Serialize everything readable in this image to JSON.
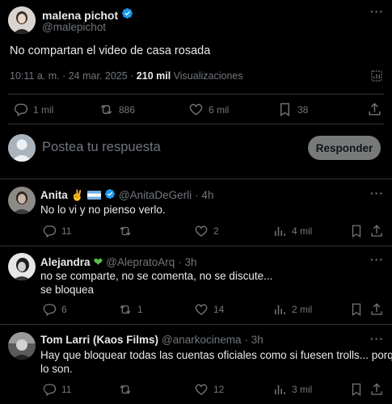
{
  "post": {
    "author_name": "malena pichot",
    "author_handle": "@malepichot",
    "text": "No compartan el video de casa rosada",
    "time": "10:11 a. m. · 24 mar. 2025 · ",
    "views_count": "210 mil",
    "views_label": " Visualizaciones",
    "actions": {
      "replies": "1 mil",
      "reposts": "886",
      "likes": "6 mil",
      "bookmarks": "38"
    }
  },
  "composer": {
    "placeholder": "Postea tu respuesta",
    "submit_label": "Responder"
  },
  "replies": [
    {
      "name": "Anita",
      "handle": "@AnitaDeGerli",
      "time": "· 4h",
      "text": "No lo vi y no pienso verlo.",
      "replies": "11",
      "reposts": "",
      "likes": "2",
      "views": "4 mil"
    },
    {
      "name": "Alejandra",
      "handle": "@AlepratoArq",
      "time": "· 3h",
      "text_line1": "no se comparte, no se comenta, no se discute...",
      "text_line2": "se bloquea",
      "replies": "6",
      "reposts": "1",
      "likes": "14",
      "views": "2 mil"
    },
    {
      "name": "Tom Larri (Kaos Films)",
      "handle": "@anarkocinema",
      "time": "· 3h",
      "text_line1": "Hay que bloquear todas las cuentas oficiales como si fuesen trolls... porque",
      "text_line2": "lo son.",
      "replies": "11",
      "reposts": "",
      "likes": "12",
      "views": "3 mil"
    }
  ],
  "colors": {
    "background": "#000000",
    "text": "#e7e9ea",
    "muted": "#71767b",
    "verified": "#1d9bf0",
    "divider": "#2f3336",
    "button_bg": "#eff3f4",
    "heart_emoji": "#5fbf4a"
  }
}
